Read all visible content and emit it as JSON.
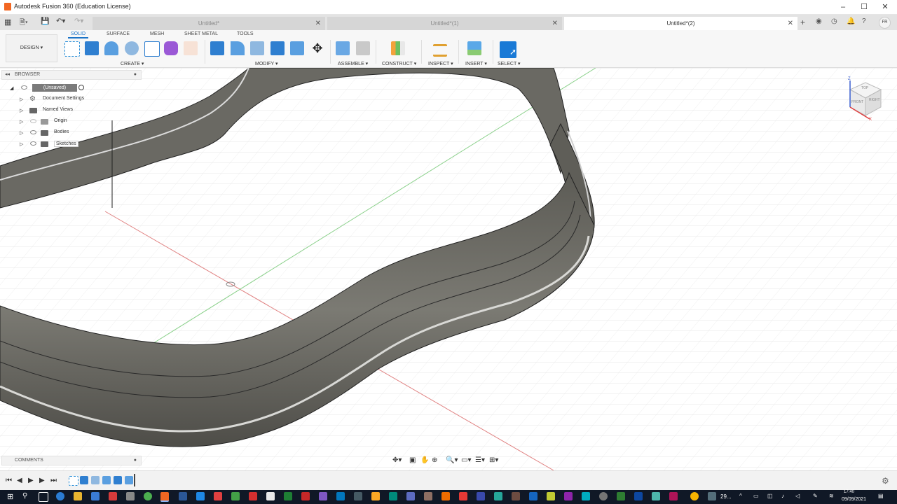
{
  "window": {
    "title": "Autodesk Fusion 360 (Education License)"
  },
  "tabs": [
    {
      "label": "Untitled*",
      "active": false
    },
    {
      "label": "Untitled*(1)",
      "active": false
    },
    {
      "label": "Untitled*(2)",
      "active": true
    }
  ],
  "user_initials": "FR",
  "toolbar": {
    "workspace": "DESIGN ▾",
    "tabs": [
      "SOLID",
      "SURFACE",
      "MESH",
      "SHEET METAL",
      "TOOLS"
    ],
    "groups": [
      "CREATE ▾",
      "MODIFY ▾",
      "ASSEMBLE ▾",
      "CONSTRUCT ▾",
      "INSPECT ▾",
      "INSERT ▾",
      "SELECT ▾"
    ]
  },
  "browser": {
    "title": "BROWSER",
    "root": "(Unsaved)",
    "items": [
      "Document Settings",
      "Named Views",
      "Origin",
      "Bodies",
      "Sketches"
    ]
  },
  "comments": {
    "title": "COMMENTS"
  },
  "viewcube": {
    "top": "TOP",
    "front": "FRONT",
    "right": "RIGHT",
    "axis_x": "X",
    "axis_z": "Z"
  },
  "taskbar": {
    "item_count_text": "29...",
    "date": "09/09/2021",
    "time": "17:40"
  },
  "colors": {
    "accent": "#1a73c7",
    "model": "#6b6a63",
    "x_axis": "#e05050",
    "y_axis": "#60c060"
  }
}
